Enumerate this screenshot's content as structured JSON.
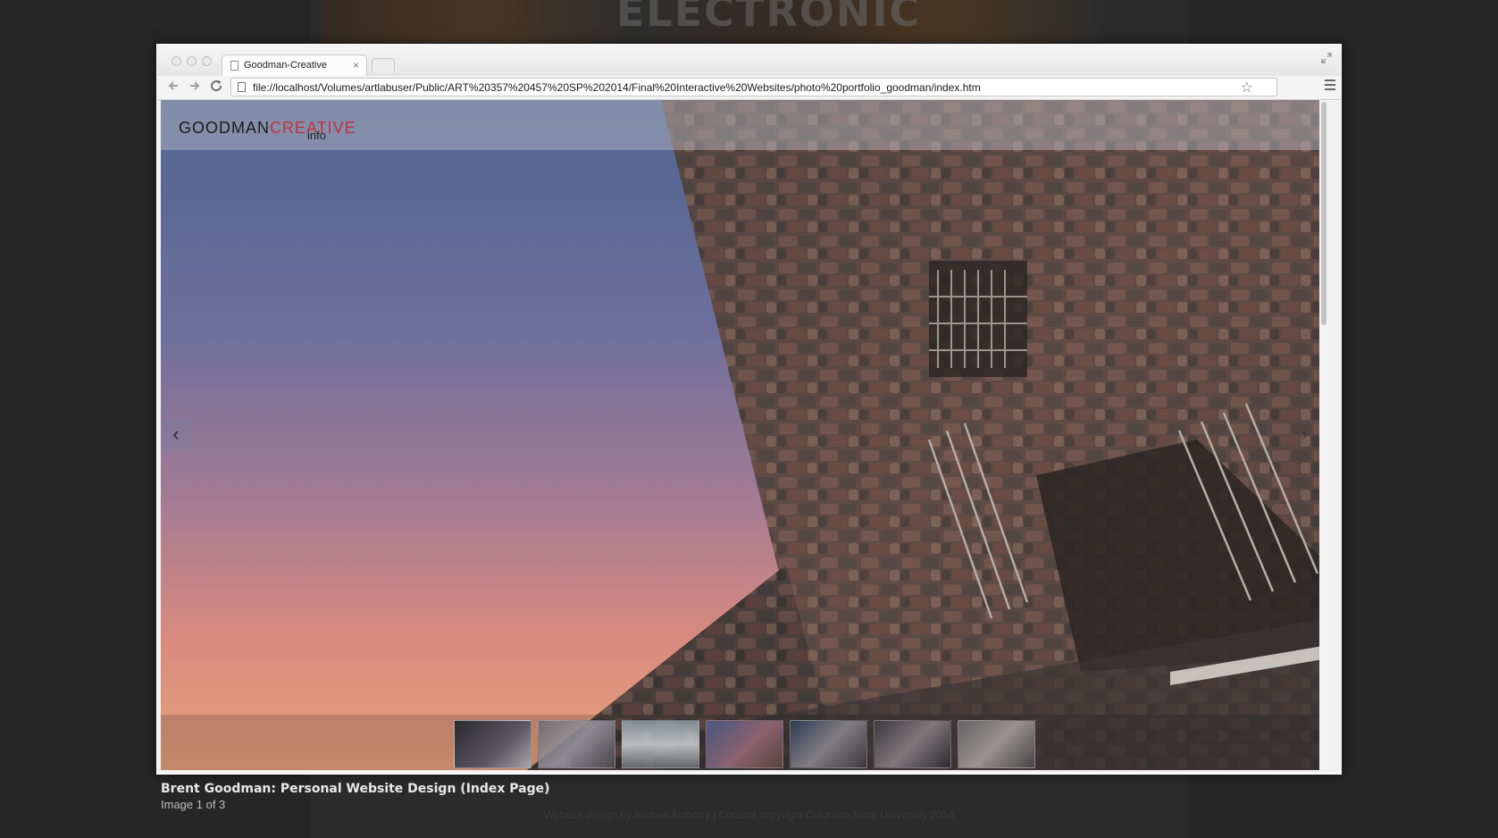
{
  "backdrop": {
    "heading": "ELECTRONIC",
    "footer": "Website design by Andrea Anthony | Content copyright Colorado State University 2014"
  },
  "browser": {
    "tab_title": "Goodman-Creative",
    "tab_close": "×",
    "url": "file://localhost/Volumes/artlabuser/Public/ART%20357%20457%20SP%202014/Final%20Interactive%20Websites/photo%20portfolio_goodman/index.htm",
    "icons": {
      "back": "back-arrow-icon",
      "forward": "forward-arrow-icon",
      "reload": "reload-icon",
      "bookmark": "star-icon",
      "menu": "hamburger-menu-icon",
      "fullscreen": "fullscreen-icon"
    }
  },
  "site": {
    "logo_part1": "GOODMAN",
    "logo_part2": "CREATIVE",
    "info_link": "info",
    "prev_arrow": "‹",
    "next_arrow": "›",
    "colors": {
      "logo_accent": "#c03243",
      "sky_top": "#556a8f",
      "sky_bottom": "#e07a5c"
    },
    "thumbnails": [
      {
        "name": "thumb-1",
        "active": true
      },
      {
        "name": "thumb-2",
        "active": false
      },
      {
        "name": "thumb-3",
        "active": false
      },
      {
        "name": "thumb-4",
        "active": false
      },
      {
        "name": "thumb-5",
        "active": false
      },
      {
        "name": "thumb-6",
        "active": false
      },
      {
        "name": "thumb-7",
        "active": false
      }
    ]
  },
  "caption": {
    "title": "Brent Goodman: Personal Website Design (Index Page)",
    "count": "Image 1 of 3"
  }
}
